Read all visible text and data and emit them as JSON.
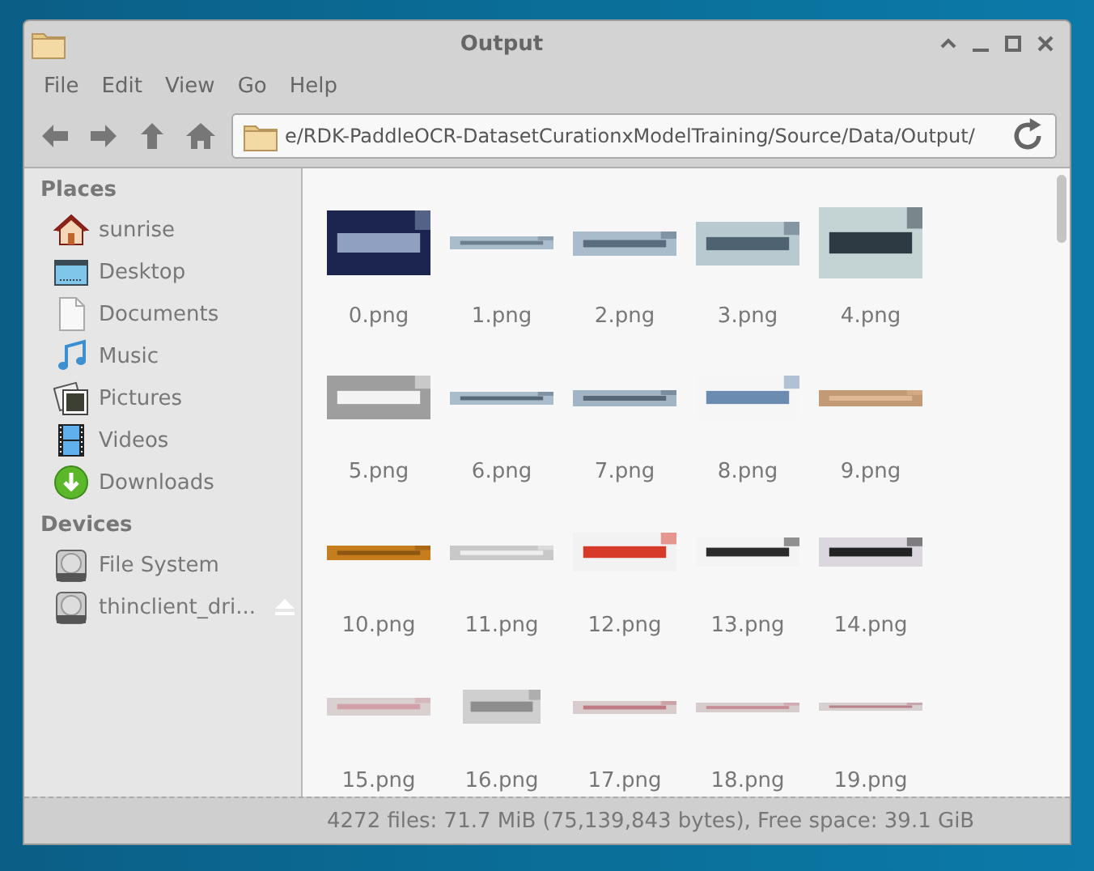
{
  "window": {
    "title": "Output"
  },
  "menu": [
    "File",
    "Edit",
    "View",
    "Go",
    "Help"
  ],
  "location": {
    "value": "e/RDK-PaddleOCR-DatasetCurationxModelTraining/Source/Data/Output/"
  },
  "sidebar": {
    "sections": [
      {
        "title": "Places",
        "items": [
          {
            "kind": "home",
            "label": "sunrise",
            "ejectable": false
          },
          {
            "kind": "desktop",
            "label": "Desktop",
            "ejectable": false
          },
          {
            "kind": "documents",
            "label": "Documents",
            "ejectable": false
          },
          {
            "kind": "music",
            "label": "Music",
            "ejectable": false
          },
          {
            "kind": "pictures",
            "label": "Pictures",
            "ejectable": false
          },
          {
            "kind": "videos",
            "label": "Videos",
            "ejectable": false
          },
          {
            "kind": "downloads",
            "label": "Downloads",
            "ejectable": false
          }
        ]
      },
      {
        "title": "Devices",
        "items": [
          {
            "kind": "drive",
            "label": "File System",
            "ejectable": false
          },
          {
            "kind": "drive",
            "label": "thinclient_dri...",
            "ejectable": true
          }
        ]
      }
    ]
  },
  "files": [
    {
      "name": "0.png",
      "kind": "picture"
    },
    {
      "name": "1.png",
      "kind": "picture"
    },
    {
      "name": "2.png",
      "kind": "picture"
    },
    {
      "name": "3.png",
      "kind": "picture"
    },
    {
      "name": "4.png",
      "kind": "picture"
    },
    {
      "name": "5.png",
      "kind": "picture"
    },
    {
      "name": "6.png",
      "kind": "picture"
    },
    {
      "name": "7.png",
      "kind": "picture"
    },
    {
      "name": "8.png",
      "kind": "picture"
    },
    {
      "name": "9.png",
      "kind": "picture"
    },
    {
      "name": "10.png",
      "kind": "picture"
    },
    {
      "name": "11.png",
      "kind": "picture"
    },
    {
      "name": "12.png",
      "kind": "picture"
    },
    {
      "name": "13.png",
      "kind": "picture"
    },
    {
      "name": "14.png",
      "kind": "picture"
    },
    {
      "name": "15.png",
      "kind": "picture"
    },
    {
      "name": "16.png",
      "kind": "picture"
    },
    {
      "name": "17.png",
      "kind": "picture"
    },
    {
      "name": "18.png",
      "kind": "picture"
    },
    {
      "name": "19.png",
      "kind": "picture"
    }
  ],
  "status_bar": "4272 files: 71.7 MiB (75,139,843 bytes), Free space: 39.1 GiB"
}
